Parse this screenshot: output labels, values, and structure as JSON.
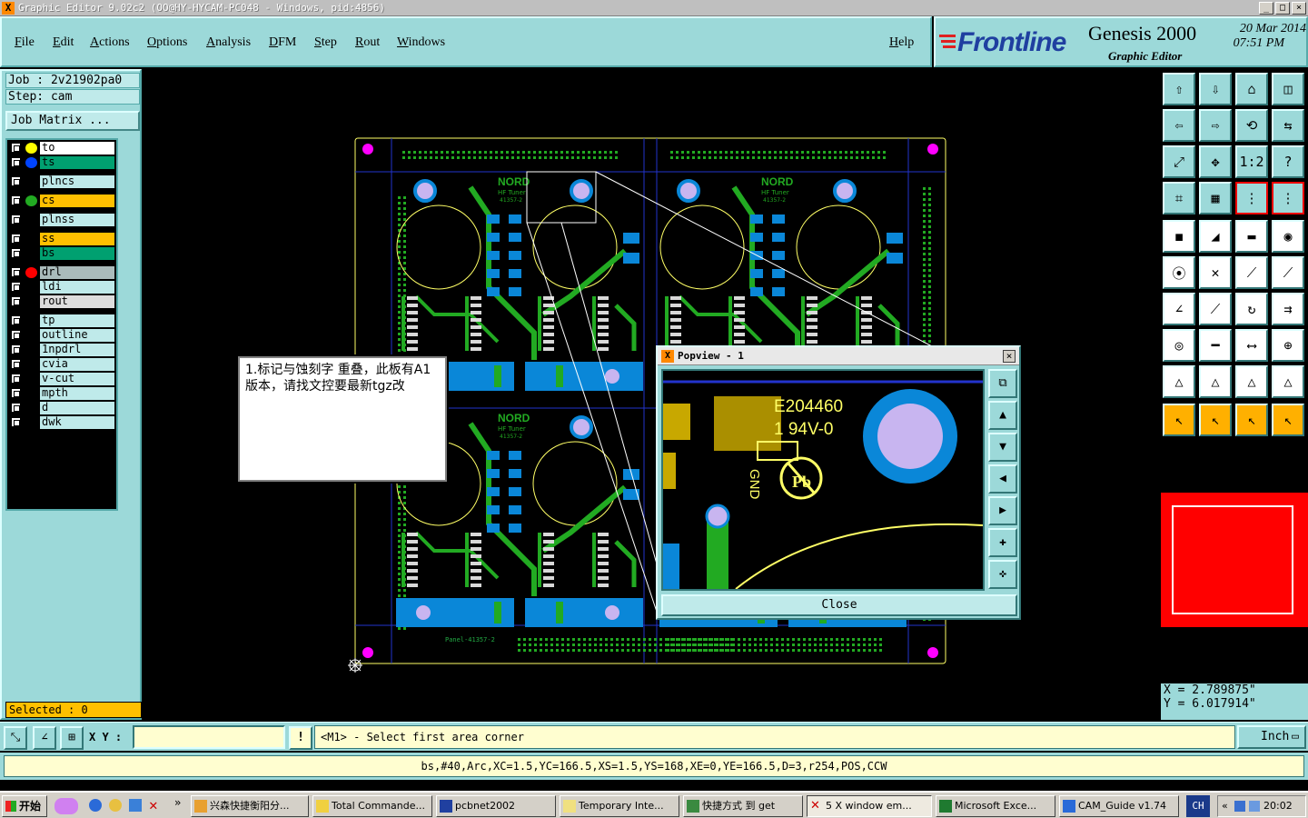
{
  "window": {
    "title": "Graphic Editor 9.02c2 (OO@HY-HYCAM-PC048 - Windows, pid:4856)"
  },
  "menu": {
    "items": [
      "File",
      "Edit",
      "Actions",
      "Options",
      "Analysis",
      "DFM",
      "Step",
      "Rout",
      "Windows"
    ],
    "help": "Help"
  },
  "brand": {
    "logo": "Frontline",
    "product": "Genesis 2000",
    "subtitle": "Graphic Editor",
    "date": "20 Mar 2014",
    "time": "07:51 PM"
  },
  "job": {
    "job_label": "Job : 2v21902pa0",
    "step_label": "Step: cam",
    "matrix_button": "Job Matrix ..."
  },
  "layers": [
    {
      "name": "to",
      "color": "#ffffff",
      "dot": "#ffff00"
    },
    {
      "name": "ts",
      "color": "#00a070",
      "dot": "#0044ff"
    },
    {
      "name": "plncs",
      "color": "#bfeaea",
      "dot": ""
    },
    {
      "name": "cs",
      "color": "#ffc000",
      "dot": "#22aa22"
    },
    {
      "name": "plnss",
      "color": "#bfeaea",
      "dot": ""
    },
    {
      "name": "ss",
      "color": "#ffc000",
      "dot": ""
    },
    {
      "name": "bs",
      "color": "#00a070",
      "dot": ""
    },
    {
      "name": "drl",
      "color": "#aabbbb",
      "dot": "#ff0000"
    },
    {
      "name": "ldi",
      "color": "#bfeaea",
      "dot": ""
    },
    {
      "name": "rout",
      "color": "#dddddd",
      "dot": ""
    },
    {
      "name": "tp",
      "color": "#bfeaea",
      "dot": ""
    },
    {
      "name": "outline",
      "color": "#bfeaea",
      "dot": ""
    },
    {
      "name": "1npdrl",
      "color": "#bfeaea",
      "dot": ""
    },
    {
      "name": "cvia",
      "color": "#bfeaea",
      "dot": ""
    },
    {
      "name": "v-cut",
      "color": "#bfeaea",
      "dot": ""
    },
    {
      "name": "mpth",
      "color": "#bfeaea",
      "dot": ""
    },
    {
      "name": "d",
      "color": "#bfeaea",
      "dot": ""
    },
    {
      "name": "dwk",
      "color": "#bfeaea",
      "dot": ""
    }
  ],
  "selected": "Selected : 0",
  "note": "1.标记与蚀刻字 重叠，此板有A1版本，请找文控要最新tgz改",
  "board": {
    "brand_text": "NORD",
    "tuner_text": "HF Tuner",
    "part_text": "41357-2",
    "panel_text": "Panel-41357-2"
  },
  "popview": {
    "title": "Popview - 1",
    "ul_text": "E204460",
    "rating_text": "1 94V-0",
    "gnd_text": "GND",
    "pb_text": "Pb",
    "close_label": "Close"
  },
  "coords": {
    "x": "X = 2.789875\"",
    "y": "Y = 6.017914\""
  },
  "command": {
    "xy_label": "X Y :",
    "xy_value": "",
    "prompt": "<M1> - Select first area corner",
    "unit": "Inch"
  },
  "info": "bs,#40,Arc,XC=1.5,YC=166.5,XS=1.5,YS=168,XE=0,YE=166.5,D=3,r254,POS,CCW",
  "taskbar": {
    "start": "开始",
    "items": [
      "兴森快捷衡阳分...",
      "Total Commande...",
      "pcbnet2002",
      "Temporary Inte...",
      "快捷方式 到 get",
      "5 X window em...",
      "Microsoft Exce...",
      "CAM_Guide v1.74"
    ],
    "lang": "CH",
    "clock": "20:02"
  }
}
